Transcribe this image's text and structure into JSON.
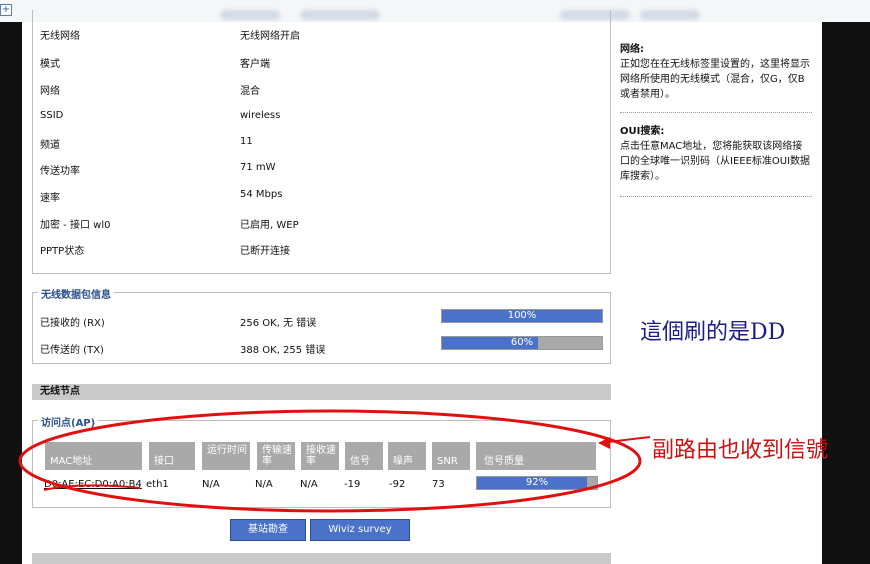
{
  "status": {
    "rows": [
      {
        "label": "无线网络",
        "value": "无线网络开启"
      },
      {
        "label": "模式",
        "value": "客户端"
      },
      {
        "label": "网络",
        "value": "混合"
      },
      {
        "label": "SSID",
        "value": "wireless"
      },
      {
        "label": "频道",
        "value": "11"
      },
      {
        "label": "传送功率",
        "value": "71 mW"
      },
      {
        "label": "速率",
        "value": "54 Mbps"
      },
      {
        "label": "加密 - 接口 wl0",
        "value": "已启用, WEP"
      },
      {
        "label": "PPTP状态",
        "value": "已断开连接"
      }
    ]
  },
  "packets": {
    "legend": "无线数据包信息",
    "rx": {
      "label": "已接收的 (RX)",
      "value": "256 OK, 无 错误",
      "pct_text": "100%",
      "fraction": 1.0
    },
    "tx": {
      "label": "已传送的 (TX)",
      "value": "388 OK, 255 错误",
      "pct_text": "60%",
      "fraction": 0.6
    }
  },
  "nodes": {
    "header": "无线节点",
    "ap_legend": "访问点(AP)",
    "columns": [
      "MAC地址",
      "接口",
      "运行时间",
      "传输速率",
      "接收速率",
      "信号",
      "噪声",
      "SNR",
      "信号质量"
    ],
    "row": {
      "mac": "D0:AE:EC:D0:A0:B4",
      "iface": "eth1",
      "uptime": "N/A",
      "tx_rate": "N/A",
      "rx_rate": "N/A",
      "signal": "-19",
      "noise": "-92",
      "snr": "73",
      "quality_text": "92%",
      "quality_fraction": 0.92
    }
  },
  "buttons": {
    "site_survey": "基站勘查",
    "wiviz": "Wiviz survey"
  },
  "help": {
    "network_title": "网络:",
    "network_text": "正如您在在无线标签里设置的，这里将显示网络所使用的无线模式（混合，仅G，仅B或者禁用）。",
    "oui_title": "OUI搜索:",
    "oui_text": "点击任意MAC地址，您将能获取该网络接口的全球唯一识别码（从IEEE标准OUI数据库搜索）。"
  },
  "annotations": {
    "dd_note": "這個刷的是DD",
    "signal_note": "副路由也收到信號"
  },
  "colors": {
    "bar_fill": "#4a72c8",
    "bar_bg": "#a9a9a9",
    "header_bg": "#c9c9c9",
    "legend_text": "#2c4f8a",
    "annotation_red": "#cc1111",
    "annotation_blue": "#1a1a8c"
  }
}
